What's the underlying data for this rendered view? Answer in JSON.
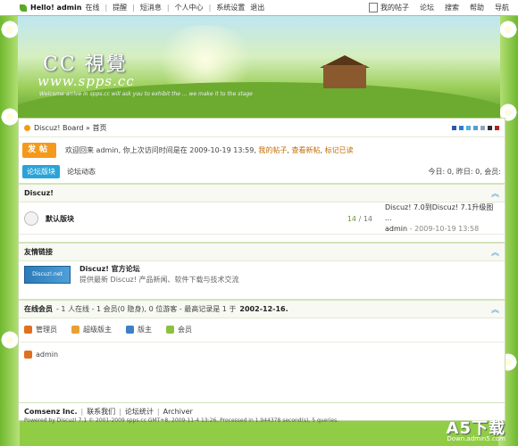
{
  "topbar": {
    "greeting": "Hello!",
    "username": "admin",
    "status": "在线",
    "left_links": [
      "提醒",
      "短消息",
      "个人中心",
      "系统设置",
      "退出"
    ],
    "right_links": [
      "我的帖子",
      "论坛",
      "搜索",
      "帮助",
      "导航"
    ]
  },
  "banner": {
    "logo": "CC 視覺",
    "url": "www.spps.cc",
    "welcome": "Welcome arrive in spps.cc will ask you to exhibit the ... we make it to the stage"
  },
  "breadcrumb": {
    "text": "Discuz! Board » 首页"
  },
  "style_swatches": [
    "#2b5aa8",
    "#2a7fd0",
    "#4fb2d9",
    "#5a9bd4",
    "#8aa4c0",
    "#2d2d2d",
    "#b0251d"
  ],
  "notice": {
    "post_label": "发帖",
    "text": "欢迎回来 admin, 你上次访问时间是在 2009-10-19 13:59,",
    "link1": "我的帖子",
    "link2": "查看新帖",
    "link3": "标记已读"
  },
  "tabs": {
    "active": "论坛版块",
    "other": "论坛动态",
    "stats": "今日: 0, 昨日: 0, 会员:"
  },
  "category": {
    "title": "Discuz!",
    "forum": {
      "name": "默认版块",
      "topics": "14",
      "posts": "14",
      "last_title": "Discuz! 7.0到Discuz! 7.1升级图 ...",
      "last_author": "admin",
      "last_date": "2009-10-19 13:58"
    }
  },
  "links_section": {
    "title": "友情链接",
    "site_logo_text": "Discuz!.net",
    "site_name": "Discuz! 官方论坛",
    "site_desc": "提供最新 Discuz! 产品新闻、软件下载与技术交流"
  },
  "online": {
    "title": "在线会员",
    "summary": "- 1 人在线 - 1 会员(0 隐身), 0 位游客 - 最高记录是 1 于",
    "record_date": "2002-12-16.",
    "legend": [
      {
        "label": "管理员",
        "color": "#e07020"
      },
      {
        "label": "超级版主",
        "color": "#e8a030"
      },
      {
        "label": "版主",
        "color": "#3d7fc8"
      },
      {
        "label": "会员",
        "color": "#8cc040"
      }
    ],
    "user": "admin"
  },
  "footer": {
    "brand": "Comsenz Inc.",
    "links": [
      "联系我们",
      "论坛统计",
      "Archiver"
    ],
    "powered": "Powered by Discuz! 7.1 © 2001-2009 spps.cc GMT+8, 2009-11-4 13:26, Processed in 1.944378 second(s), 5 queries."
  },
  "watermark": {
    "big": "A5下载",
    "small": "Down.admin5.com"
  }
}
